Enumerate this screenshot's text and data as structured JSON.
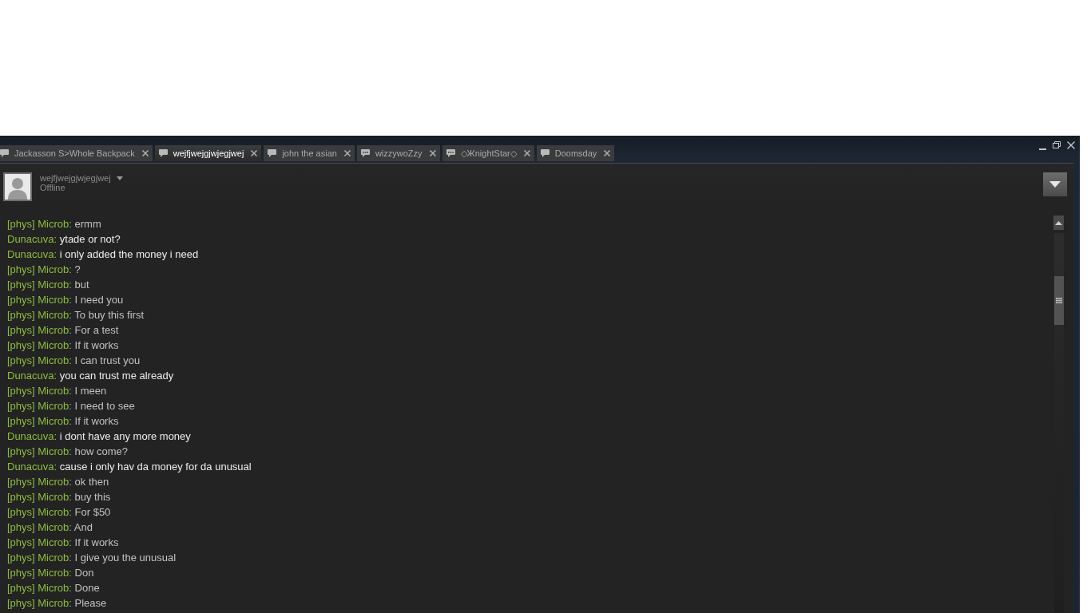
{
  "tabs": [
    {
      "label": "Jackasson S>Whole Backpack",
      "selected": false,
      "unread": false
    },
    {
      "label": "wejfjwejgjwjegjwej",
      "selected": true,
      "unread": false
    },
    {
      "label": "john the asian",
      "selected": false,
      "unread": false
    },
    {
      "label": "wizzywoZzy",
      "selected": false,
      "unread": true
    },
    {
      "label": "◇ЖnightStar◇",
      "selected": false,
      "unread": true
    },
    {
      "label": "Doomsday",
      "selected": false,
      "unread": false
    }
  ],
  "header": {
    "name": "wejfjwejgjwjegjwej",
    "status": "Offline"
  },
  "messages": [
    {
      "sender": "[phys] Microb:",
      "text": "ermm",
      "kind": "friend"
    },
    {
      "sender": "Dunacuva:",
      "text": "ytade or not?",
      "kind": "self"
    },
    {
      "sender": "Dunacuva:",
      "text": "i only added the money i need",
      "kind": "self"
    },
    {
      "sender": "[phys] Microb:",
      "text": "?",
      "kind": "friend"
    },
    {
      "sender": "[phys] Microb:",
      "text": "but",
      "kind": "friend"
    },
    {
      "sender": "[phys] Microb:",
      "text": "I need you",
      "kind": "friend"
    },
    {
      "sender": "[phys] Microb:",
      "text": "To buy this first",
      "kind": "friend"
    },
    {
      "sender": "[phys] Microb:",
      "text": "For a test",
      "kind": "friend"
    },
    {
      "sender": "[phys] Microb:",
      "text": "If it works",
      "kind": "friend"
    },
    {
      "sender": "[phys] Microb:",
      "text": "I can trust you",
      "kind": "friend"
    },
    {
      "sender": "Dunacuva:",
      "text": "you can trust me already",
      "kind": "self"
    },
    {
      "sender": "[phys] Microb:",
      "text": "I meen",
      "kind": "friend"
    },
    {
      "sender": "[phys] Microb:",
      "text": "I need to see",
      "kind": "friend"
    },
    {
      "sender": "[phys] Microb:",
      "text": "If it works",
      "kind": "friend"
    },
    {
      "sender": "Dunacuva:",
      "text": "i dont have any more money",
      "kind": "self"
    },
    {
      "sender": "[phys] Microb:",
      "text": "how come?",
      "kind": "friend"
    },
    {
      "sender": "Dunacuva:",
      "text": "cause i only hav da money for da unusual",
      "kind": "self"
    },
    {
      "sender": "[phys] Microb:",
      "text": "ok then",
      "kind": "friend"
    },
    {
      "sender": "[phys] Microb:",
      "text": "buy this",
      "kind": "friend"
    },
    {
      "sender": "[phys] Microb:",
      "text": "For $50",
      "kind": "friend"
    },
    {
      "sender": "[phys] Microb:",
      "text": "And",
      "kind": "friend"
    },
    {
      "sender": "[phys] Microb:",
      "text": "If it works",
      "kind": "friend"
    },
    {
      "sender": "[phys] Microb:",
      "text": "I give you the unusual",
      "kind": "friend"
    },
    {
      "sender": "[phys] Microb:",
      "text": "Don",
      "kind": "friend"
    },
    {
      "sender": "[phys] Microb:",
      "text": "Done",
      "kind": "friend"
    },
    {
      "sender": "[phys] Microb:",
      "text": "Please",
      "kind": "friend"
    }
  ]
}
